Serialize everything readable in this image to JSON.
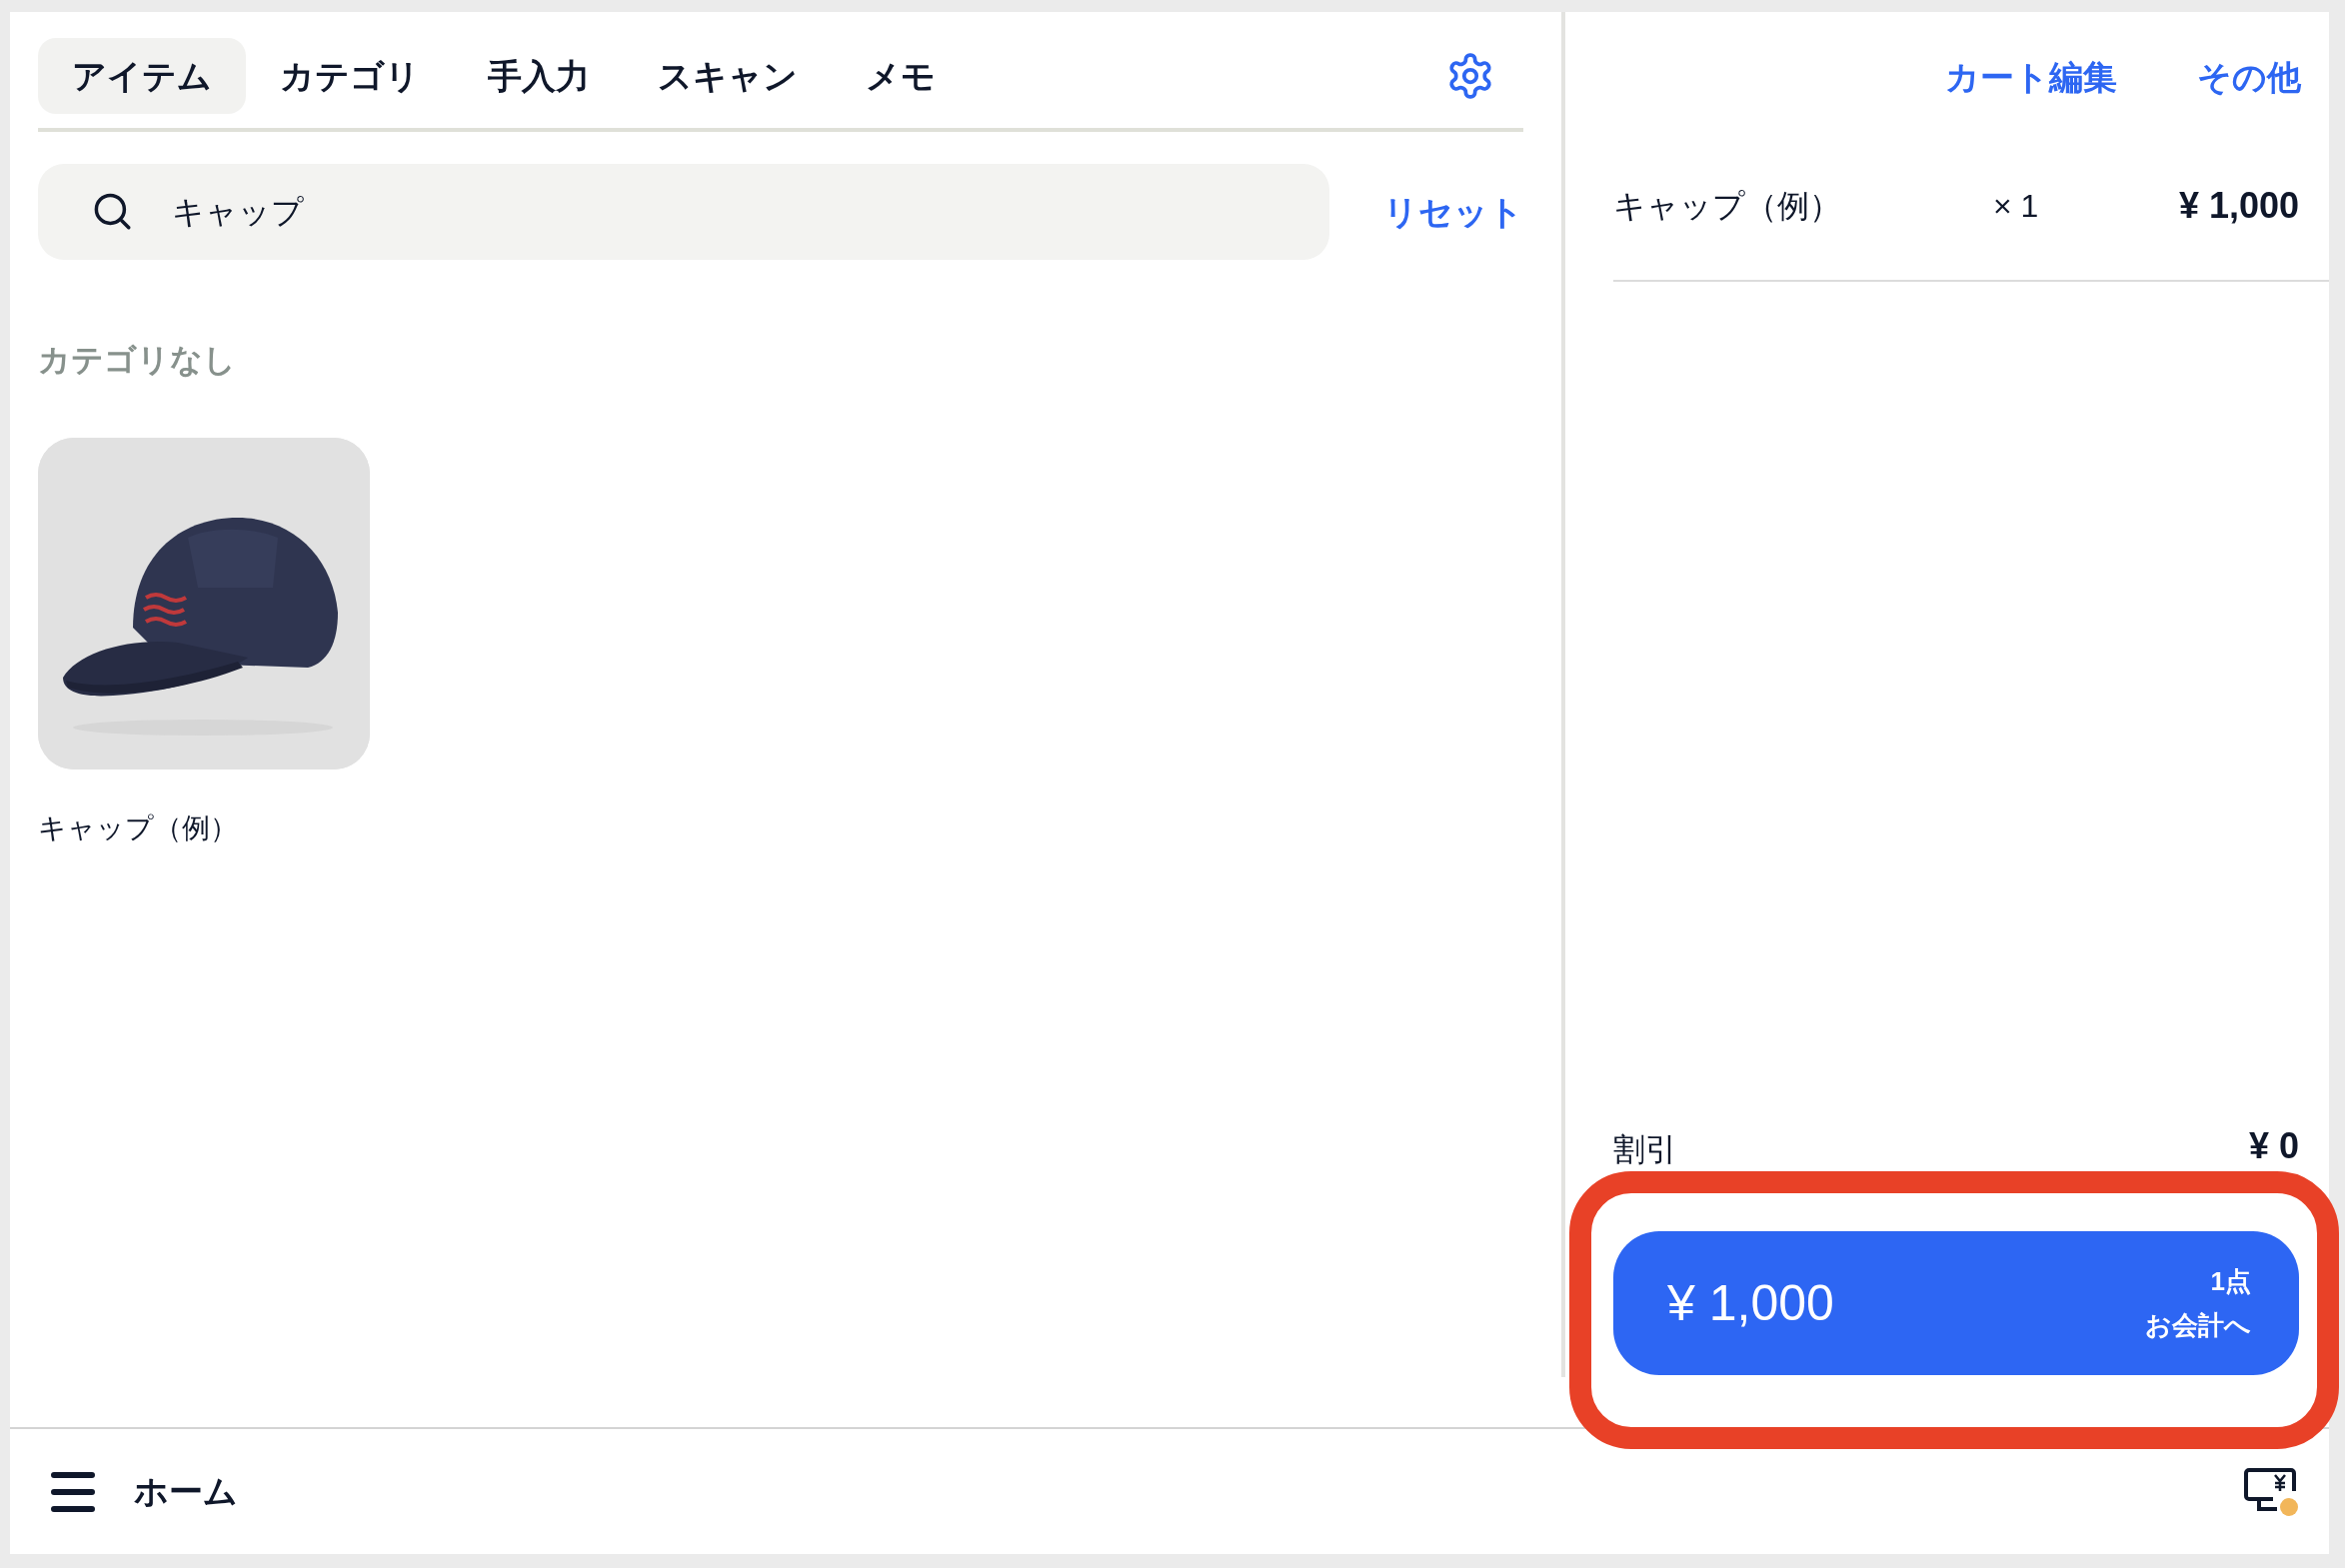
{
  "tabs": [
    {
      "label": "アイテム",
      "selected": true
    },
    {
      "label": "カテゴリ",
      "selected": false
    },
    {
      "label": "手入力",
      "selected": false
    },
    {
      "label": "スキャン",
      "selected": false
    },
    {
      "label": "メモ",
      "selected": false
    }
  ],
  "search": {
    "value": "キャップ"
  },
  "reset_link": "リセット",
  "category_heading": "カテゴリなし",
  "items": [
    {
      "name": "キャップ（例）",
      "kind": "picture"
    }
  ],
  "cart": {
    "actions": [
      "カート編集",
      "その他"
    ],
    "lines": [
      {
        "name": "キャップ（例）",
        "quantity": "× 1",
        "price": "¥ 1,000"
      }
    ],
    "discount": {
      "label": "割引",
      "amount": "¥ 0"
    },
    "checkout": {
      "total": "¥ 1,000",
      "count": "1点",
      "label": "お会計へ"
    }
  },
  "bottom_bar": {
    "title": "ホーム"
  }
}
